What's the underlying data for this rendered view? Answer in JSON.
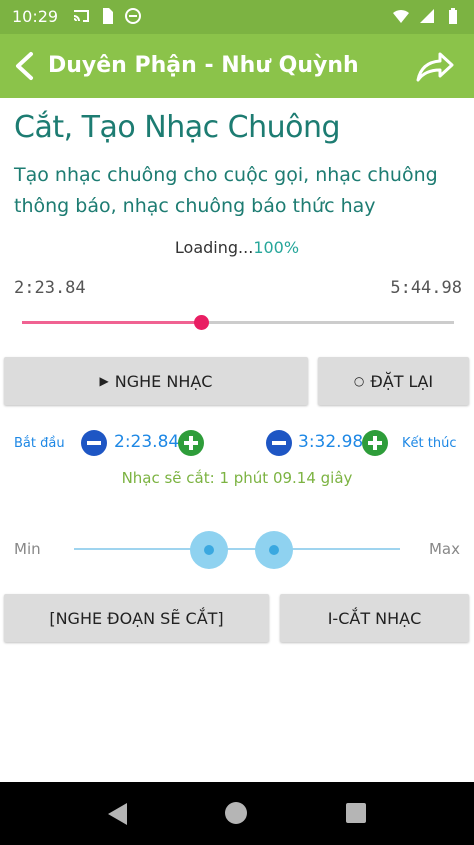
{
  "status_bar": {
    "time": "10:29",
    "bg_color": "#7cb342",
    "left_icons": [
      "cast-icon",
      "sim-card-icon",
      "no-disturb-icon"
    ],
    "right_icons": [
      "wifi-icon",
      "signal-icon",
      "battery-icon"
    ]
  },
  "app_bar": {
    "title": "Duyên Phận - Như Quỳnh",
    "bg_color": "#8bc34a",
    "back_icon": "back-arrow-icon",
    "share_icon": "share-icon"
  },
  "page": {
    "heading": "Cắt, Tạo Nhạc Chuông",
    "description": "Tạo nhạc chuông cho cuộc gọi, nhạc chuông thông báo, nhạc chuông báo thức hay",
    "loading_text": "Loading...",
    "loading_percent": "100%"
  },
  "player": {
    "current_time": "2:23.84",
    "total_time": "5:44.98",
    "progress_fraction": 0.415,
    "accent_color": "#e91e63"
  },
  "buttons": {
    "play_glyph": "▶",
    "play_label": "NGHE NHẠC",
    "reset_glyph": "○",
    "reset_label": "ĐẶT LẠI",
    "preview_label": "[NGHE ĐOẠN SẼ CẮT]",
    "cut_label": "I-CẮT NHẠC"
  },
  "trim": {
    "start_label": "Bắt đầu",
    "start_value": "2:23.84",
    "end_value": "3:32.98",
    "end_label": "Kết thúc",
    "info": "Nhạc sẽ cắt: 1 phút 09.14 giây"
  },
  "range": {
    "min_label": "Min",
    "max_label": "Max",
    "low_fraction": 0.415,
    "high_fraction": 0.615
  },
  "nav_bar": {
    "icons": [
      "nav-back-icon",
      "nav-home-icon",
      "nav-recents-icon"
    ]
  }
}
